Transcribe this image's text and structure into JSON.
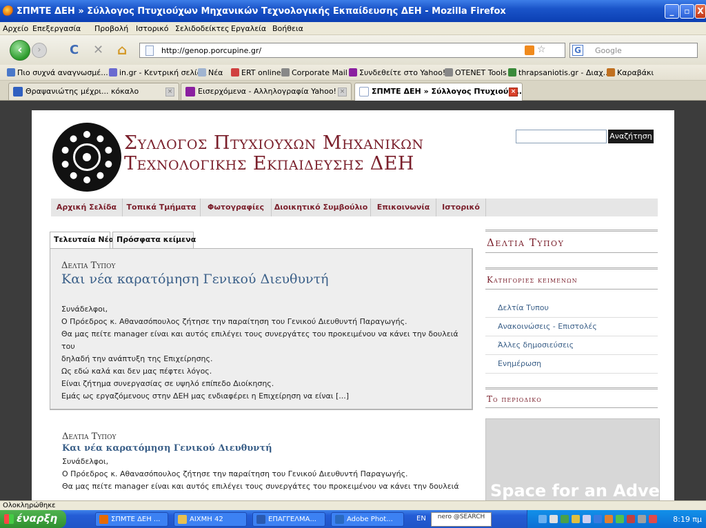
{
  "window": {
    "title": "ΣΠΜΤΕ ΔΕΗ » Σύλλογος Πτυχιούχων Μηχανικών Τεχνολογικής Εκπαίδευσης ΔΕΗ - Mozilla Firefox",
    "btn_min": "_",
    "btn_max": "▫",
    "btn_close": "X"
  },
  "menu": [
    "Αρχείο",
    "Επεξεργασία",
    "Προβολή",
    "Ιστορικό",
    "Σελιδοδείκτες",
    "Εργαλεία",
    "Βοήθεια"
  ],
  "nav": {
    "url": "http://genop.porcupine.gr/",
    "search_placeholder": "Google",
    "search_engine": "G",
    "back_glyph": "‹",
    "fwd_glyph": "›",
    "reload_glyph": "C",
    "stop_glyph": "✕",
    "home_glyph": "⌂",
    "star_glyph": "☆"
  },
  "bookmarks": [
    {
      "label": "Πιο συχνά αναγνωσμέ...",
      "color": "#4a78c9"
    },
    {
      "label": "in.gr - Κεντρική σελίδα",
      "color": "#6a6ad0"
    },
    {
      "label": "Νέα",
      "color": "#a0b4d0"
    },
    {
      "label": "ERT online",
      "color": "#d04040"
    },
    {
      "label": "Corporate Mail",
      "color": "#888"
    },
    {
      "label": "Συνδεθείτε στο Yahoo!",
      "color": "#8a1fa0"
    },
    {
      "label": "OTENET Tools",
      "color": "#888"
    },
    {
      "label": "thrapsaniotis.gr - Διαχ...",
      "color": "#3a8a3a"
    },
    {
      "label": "Καραβάκι",
      "color": "#c07020"
    }
  ],
  "tabs": [
    {
      "label": "Θραψανιώτης μέχρι... κόκαλο",
      "color": "#3060c0"
    },
    {
      "label": "Εισερχόμενα - Αλληλογραφία Yahoo!",
      "color": "#8a1fa0"
    },
    {
      "label": "ΣΠΜΤΕ ΔΕΗ » Σύλλογος Πτυχιούχ...",
      "color": "#ffffff"
    }
  ],
  "site": {
    "title_line1": "Συλλογος Πτυχιουχων Μηχανικων",
    "title_line2": "Τεχνολογικης Εκπαιδευσης ΔΕΗ",
    "search_button": "Αναζήτηση",
    "nav": [
      "Αρχική Σελίδα",
      "Τοπικά Τμήματα",
      "Φωτογραφίες",
      "Διοικητικό Συμβούλιο",
      "Επικοινωνία",
      "Ιστορικό"
    ],
    "content_tabs": [
      "Τελευταία Νέα",
      "Πρόσφατα κείμενα"
    ],
    "featured": {
      "category": "Δελτια Τυπου",
      "title": "Και νέα καρατόμηση Γενικού Διευθυντή",
      "lines": [
        "Συνάδελφοι,",
        "Ο Πρόεδρος κ. Αθανασόπουλος ζήτησε την παραίτηση του Γενικού Διευθυντή Παραγωγής.",
        "Θα μας πείτε manager είναι και αυτός επιλέγει τους συνεργάτες του προκειμένου να κάνει την δουλειά του",
        "δηλαδή την ανάπτυξη της Επιχείρησης.",
        "Ως εδώ καλά και δεν μας πέφτει λόγος.",
        "Είναι ζήτημα συνεργασίας σε υψηλό επίπεδο Διοίκησης.",
        "Εμάς ως εργαζόμενους στην ΔΕΗ μας ενδιαφέρει η Επιχείρηση να είναι [...]"
      ]
    },
    "post2": {
      "category": "Δελτια Τυπου",
      "title": "Και νέα καρατόμηση Γενικού Διευθυντή",
      "lines": [
        "Συνάδελφοι,",
        "Ο Πρόεδρος κ. Αθανασόπουλος ζήτησε την παραίτηση του Γενικού Διευθυντή Παραγωγής.",
        "Θα μας πείτε manager είναι και αυτός επιλέγει τους συνεργάτες του προκειμένου να κάνει την δουλειά"
      ]
    },
    "sidebar": {
      "press_head": "Δελτια Τυπου",
      "cats_head": "Κατηγοριες κειμενων",
      "cats": [
        "Δελτία Τυπου",
        "Ανακοινώσεις - Επιστολές",
        "Άλλες δημοσιεύσεις",
        "Ενημέρωση"
      ],
      "mag_head": "Το περιοδικο",
      "advert": "Space for an Advert"
    }
  },
  "status": "Ολοκληρώθηκε",
  "taskbar": {
    "start": "έναρξη",
    "items": [
      {
        "label": "ΣΠΜΤΕ ΔΕΗ ...",
        "color": "#e66a00"
      },
      {
        "label": "ΑΙΧΜΗ 42",
        "color": "#e8c050"
      },
      {
        "label": "ΕΠΑΓΓΕΛΜΑ...",
        "color": "#2a5ab0"
      },
      {
        "label": "Adobe Phot...",
        "color": "#2a6ac0"
      }
    ],
    "lang": "EN",
    "nero": "nero @SEARCH",
    "clock": "8:19 πμ"
  }
}
